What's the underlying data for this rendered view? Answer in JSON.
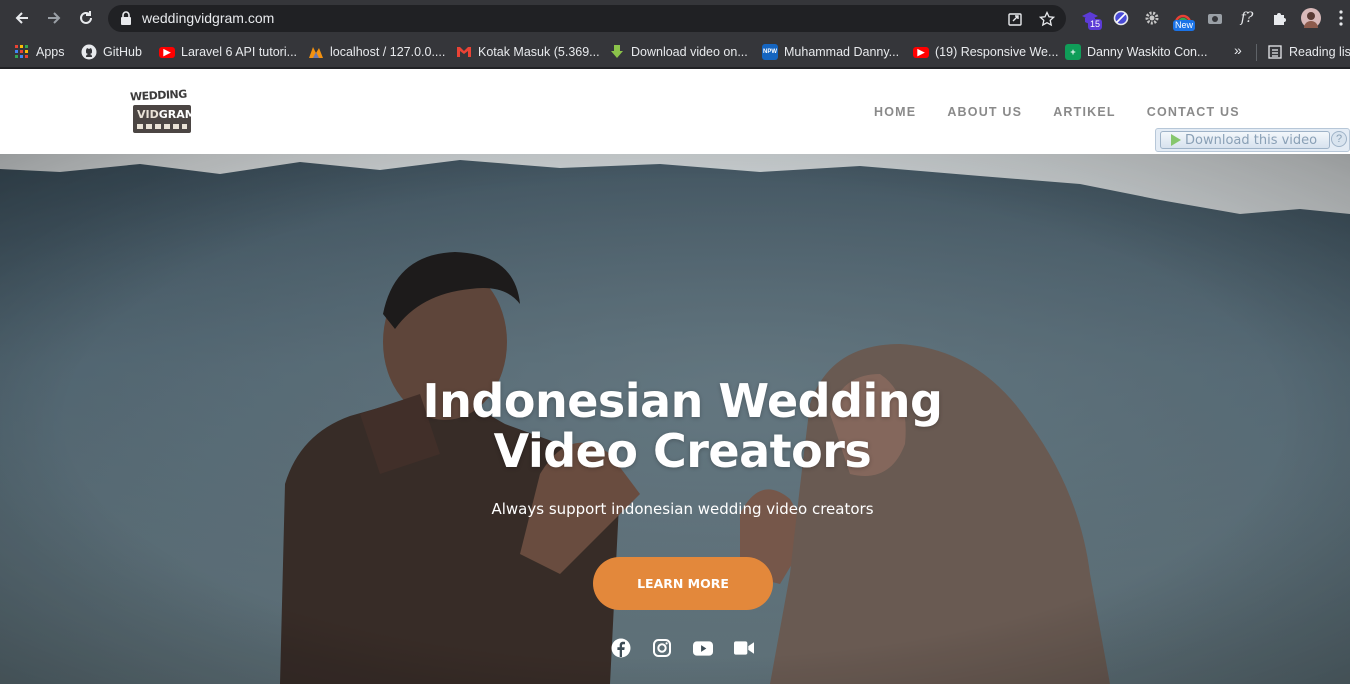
{
  "browser": {
    "url": "weddingvidgram.com",
    "extension_badges": {
      "count": "15",
      "new": "New"
    },
    "bookmarks": [
      {
        "label": "Apps",
        "icon": "apps-grid-icon"
      },
      {
        "label": "GitHub",
        "icon": "github-icon"
      },
      {
        "label": "Laravel 6 API tutori...",
        "icon": "youtube-icon"
      },
      {
        "label": "localhost / 127.0.0....",
        "icon": "phpmyadmin-icon"
      },
      {
        "label": "Kotak Masuk (5.369...",
        "icon": "gmail-icon"
      },
      {
        "label": "Download video on...",
        "icon": "download-arrow-icon"
      },
      {
        "label": "Muhammad Danny...",
        "icon": "npw-icon"
      },
      {
        "label": "(19) Responsive We...",
        "icon": "youtube-icon"
      },
      {
        "label": "Danny Waskito Con...",
        "icon": "sheets-icon"
      }
    ],
    "reading_list": "Reading list",
    "more": "»"
  },
  "site": {
    "logo": {
      "top": "WEDDING",
      "vid": "VID",
      "gram": "GRAM"
    },
    "menu": [
      "HOME",
      "ABOUT US",
      "ARTIKEL",
      "CONTACT US"
    ],
    "download_video": "Download this video",
    "download_help": "?"
  },
  "hero": {
    "title_line1": "Indonesian Wedding",
    "title_line2": "Video Creators",
    "subtitle": "Always support indonesian wedding video creators",
    "cta": "LEARN MORE",
    "socials": [
      "facebook-icon",
      "instagram-icon",
      "youtube-icon",
      "video-camera-icon"
    ]
  },
  "colors": {
    "accent": "#e3883b",
    "chrome": "#35363a",
    "menu_text": "#8a8a8a"
  }
}
